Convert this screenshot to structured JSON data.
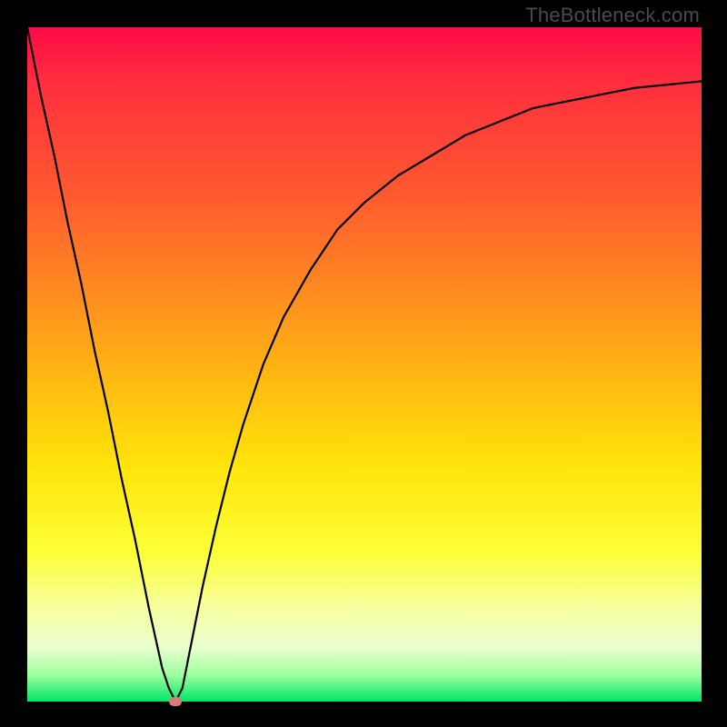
{
  "watermark": "TheBottleneck.com",
  "chart_data": {
    "type": "line",
    "title": "",
    "xlabel": "",
    "ylabel": "",
    "xlim": [
      0,
      100
    ],
    "ylim": [
      0,
      100
    ],
    "grid": false,
    "legend": false,
    "series": [
      {
        "name": "bottleneck-curve",
        "x": [
          0,
          2,
          4,
          6,
          8,
          10,
          12,
          14,
          16,
          18,
          20,
          21,
          22,
          23,
          24,
          26,
          28,
          30,
          32,
          35,
          38,
          42,
          46,
          50,
          55,
          60,
          65,
          70,
          75,
          80,
          85,
          90,
          95,
          100
        ],
        "y": [
          100,
          90,
          81,
          71,
          62,
          52,
          43,
          33,
          24,
          14,
          5,
          2,
          0,
          2,
          7,
          17,
          26,
          34,
          41,
          50,
          57,
          64,
          70,
          74,
          78,
          81,
          84,
          86,
          88,
          89,
          90,
          91,
          91.5,
          92
        ]
      }
    ],
    "marker": {
      "x": 22,
      "y": 0,
      "color": "#d77b7b"
    }
  },
  "colors": {
    "curve": "#000000",
    "marker": "#d77b7b",
    "frame": "#000000"
  }
}
